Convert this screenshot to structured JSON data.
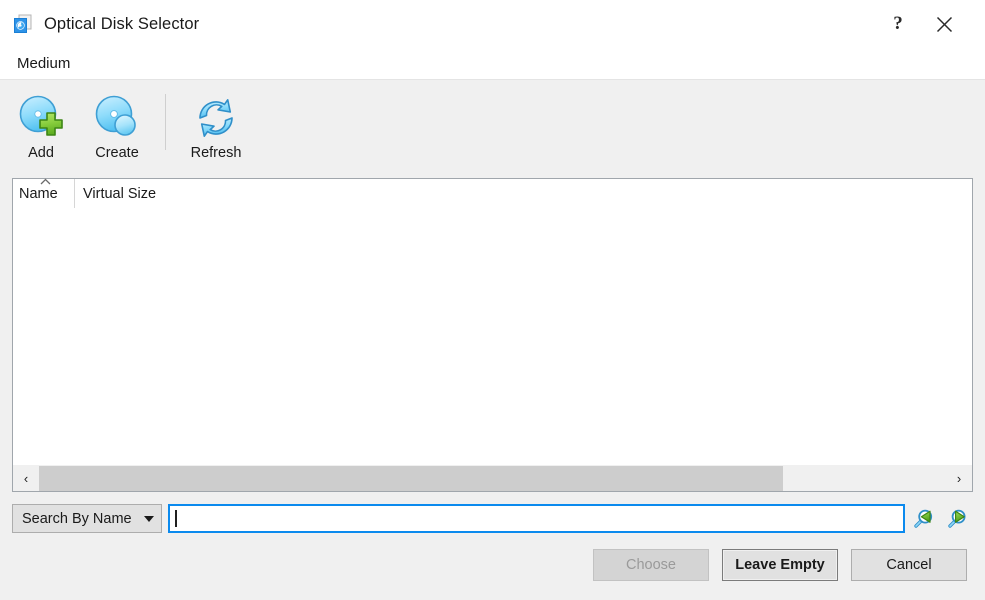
{
  "window": {
    "title": "Optical Disk Selector",
    "icon": "optical-disk-icon",
    "help_label": "?",
    "close_label": "✕"
  },
  "menubar": {
    "items": [
      {
        "label": "Medium"
      }
    ]
  },
  "toolbar": {
    "buttons": [
      {
        "label": "Add",
        "icon": "disk-add-icon"
      },
      {
        "label": "Create",
        "icon": "disk-create-icon"
      },
      {
        "label": "Refresh",
        "icon": "refresh-icon"
      }
    ]
  },
  "list": {
    "columns": [
      {
        "label": "Name",
        "sort": "ascending"
      },
      {
        "label": "Virtual Size",
        "sort": "none"
      }
    ],
    "rows": [],
    "scrollbar": {
      "left_arrow": "‹",
      "right_arrow": "›",
      "thumb_percent": 82
    }
  },
  "search": {
    "mode_label": "Search By Name",
    "value": "",
    "placeholder": "",
    "prev_icon": "search-previous-icon",
    "next_icon": "search-next-icon"
  },
  "footer": {
    "buttons": [
      {
        "label": "Choose",
        "state": "disabled"
      },
      {
        "label": "Leave Empty",
        "state": "default"
      },
      {
        "label": "Cancel",
        "state": "normal"
      }
    ]
  },
  "colors": {
    "accent": "#0b8aee",
    "window_bg": "#f0f0f0",
    "field_bg": "#ffffff",
    "icon_blue": "#3fa9f5",
    "icon_green": "#7ac943"
  }
}
